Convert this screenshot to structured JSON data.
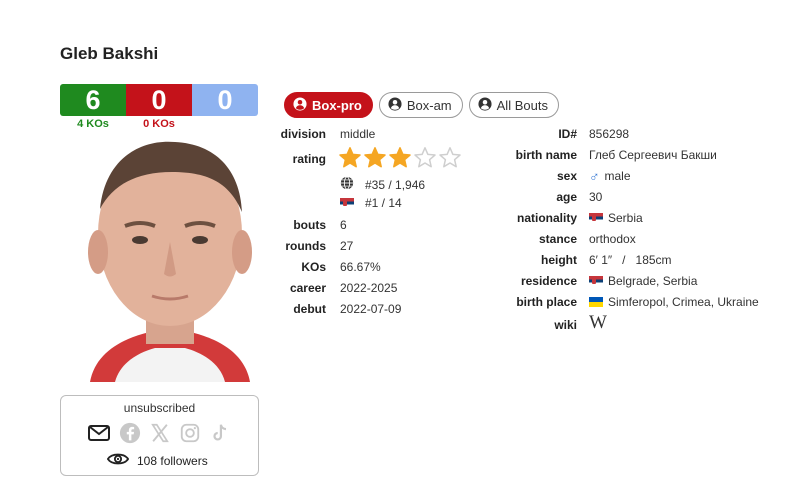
{
  "boxer": {
    "name": "Gleb Bakshi"
  },
  "record": {
    "wins": "6",
    "losses": "0",
    "draws": "0",
    "wins_ko": "4 KOs",
    "losses_ko": "0 KOs"
  },
  "subscription": {
    "status": "unsubscribed",
    "followers": "108 followers"
  },
  "tabs": [
    {
      "label": "Box-pro",
      "active": true
    },
    {
      "label": "Box-am",
      "active": false
    },
    {
      "label": "All Bouts",
      "active": false
    }
  ],
  "left_info": {
    "division_label": "division",
    "division": "middle",
    "rating_label": "rating",
    "rating_stars": 3,
    "rating_max": 5,
    "world_rank": "#35 / 1,946",
    "country_rank": "#1 / 14",
    "bouts_label": "bouts",
    "bouts": "6",
    "rounds_label": "rounds",
    "rounds": "27",
    "kos_label": "KOs",
    "kos": "66.67%",
    "career_label": "career",
    "career": "2022-2025",
    "debut_label": "debut",
    "debut": "2022-07-09"
  },
  "right_info": {
    "id_label": "ID#",
    "id": "856298",
    "birth_name_label": "birth name",
    "birth_name": "Глеб Сергеевич Бакши",
    "sex_label": "sex",
    "sex": "male",
    "age_label": "age",
    "age": "30",
    "nationality_label": "nationality",
    "nationality": "Serbia",
    "stance_label": "stance",
    "stance": "orthodox",
    "height_label": "height",
    "height": "6′ 1″   /   185cm",
    "residence_label": "residence",
    "residence": "Belgrade, Serbia",
    "birth_place_label": "birth place",
    "birth_place": "Simferopol, Crimea, Ukraine",
    "wiki_label": "wiki",
    "wiki_glyph": "W"
  },
  "colors": {
    "win": "#1f8a1f",
    "loss": "#c4121a",
    "draw": "#8fb3f0",
    "star": "#f5a623"
  }
}
